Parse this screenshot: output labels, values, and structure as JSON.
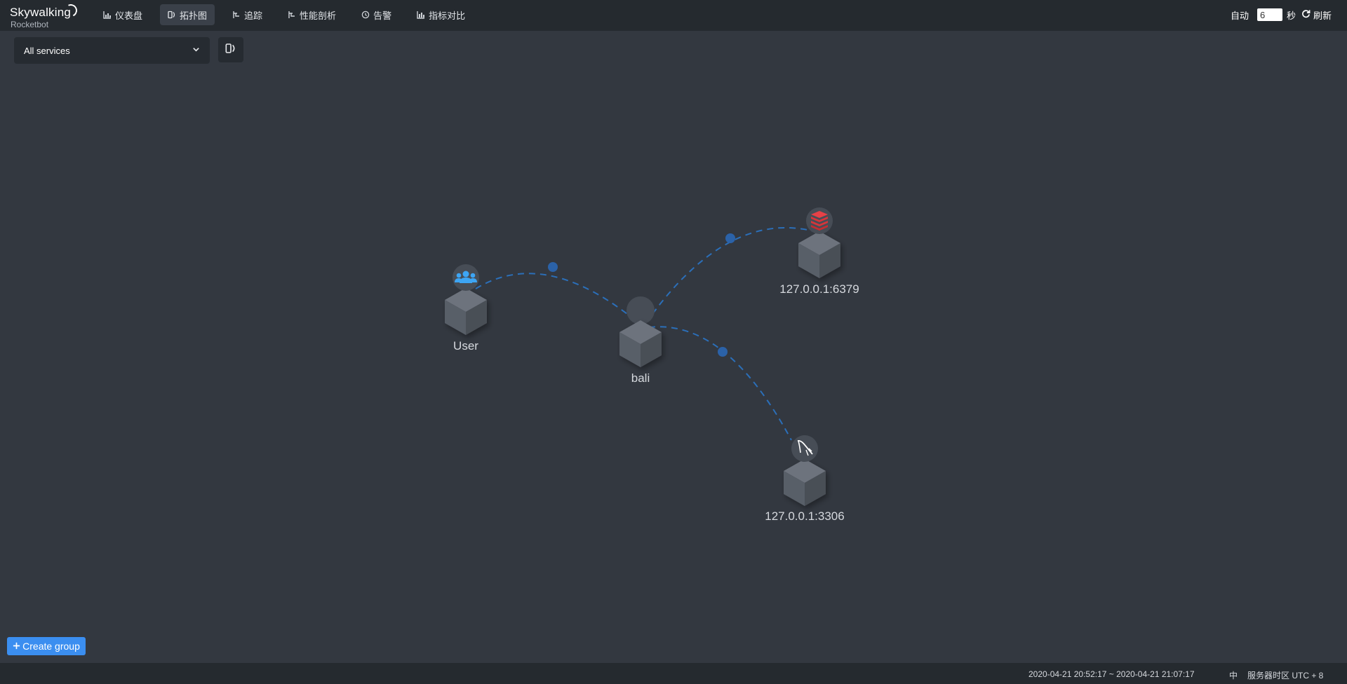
{
  "app": {
    "logo_main": "Skywalking",
    "logo_sub": "Rocketbot"
  },
  "nav": {
    "items": [
      {
        "label": "仪表盘",
        "icon": "chart-icon"
      },
      {
        "label": "拓扑图",
        "icon": "topology-icon"
      },
      {
        "label": "追踪",
        "icon": "trace-icon"
      },
      {
        "label": "性能剖析",
        "icon": "profile-icon"
      },
      {
        "label": "告警",
        "icon": "alarm-icon"
      },
      {
        "label": "指标对比",
        "icon": "compare-icon"
      }
    ],
    "active": "拓扑图"
  },
  "refresh": {
    "auto_label": "自动",
    "interval": "6",
    "unit": "秒",
    "refresh_label": "刷新"
  },
  "toolbar": {
    "service_select": "All services"
  },
  "topology": {
    "nodes": [
      {
        "id": "user",
        "label": "User",
        "badge": "users-icon",
        "badge_color": "#3da5f4"
      },
      {
        "id": "bali",
        "label": "bali",
        "badge": "service-icon",
        "badge_color": "#474d56"
      },
      {
        "id": "redis",
        "label": "127.0.0.1:6379",
        "badge": "redis-icon",
        "badge_color": "#d8353a"
      },
      {
        "id": "mysql",
        "label": "127.0.0.1:3306",
        "badge": "mysql-icon",
        "badge_color": "#ffffff"
      }
    ],
    "edges": [
      {
        "from": "user",
        "to": "bali"
      },
      {
        "from": "bali",
        "to": "redis"
      },
      {
        "from": "bali",
        "to": "mysql"
      }
    ],
    "edge_color": "#2b6fb9"
  },
  "bottom": {
    "create_group_label": "Create group"
  },
  "footer": {
    "time_range": "2020-04-21 20:52:17 ~ 2020-04-21 21:07:17",
    "lang": "中",
    "timezone": "服务器时区 UTC + 8"
  }
}
